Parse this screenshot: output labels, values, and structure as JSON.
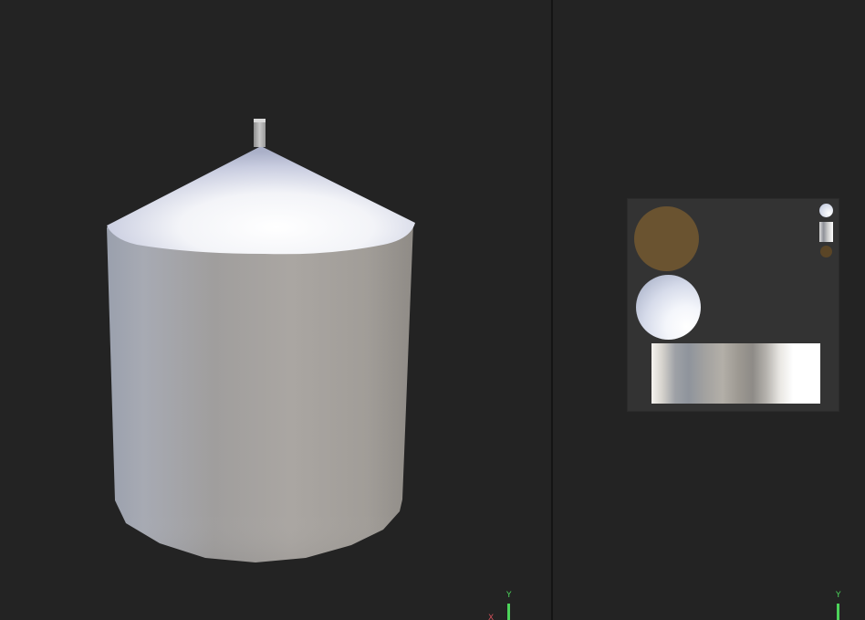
{
  "viewport_3d": {
    "axis_y_label": "Y",
    "axis_x_label": "X"
  },
  "viewport_uv": {
    "axis_y_label": "Y"
  },
  "colors": {
    "background": "#232323",
    "panel": "#333333",
    "axis_y": "#4cd35a",
    "axis_x": "#d0505a",
    "brown_swatch": "#6a5330",
    "small_dot_brown": "#5a4526"
  },
  "uv_swatches": [
    {
      "name": "brown-material-swatch",
      "kind": "flat"
    },
    {
      "name": "silver-material-swatch",
      "kind": "sphere"
    },
    {
      "name": "metal-gradient-strip",
      "kind": "strip"
    }
  ]
}
